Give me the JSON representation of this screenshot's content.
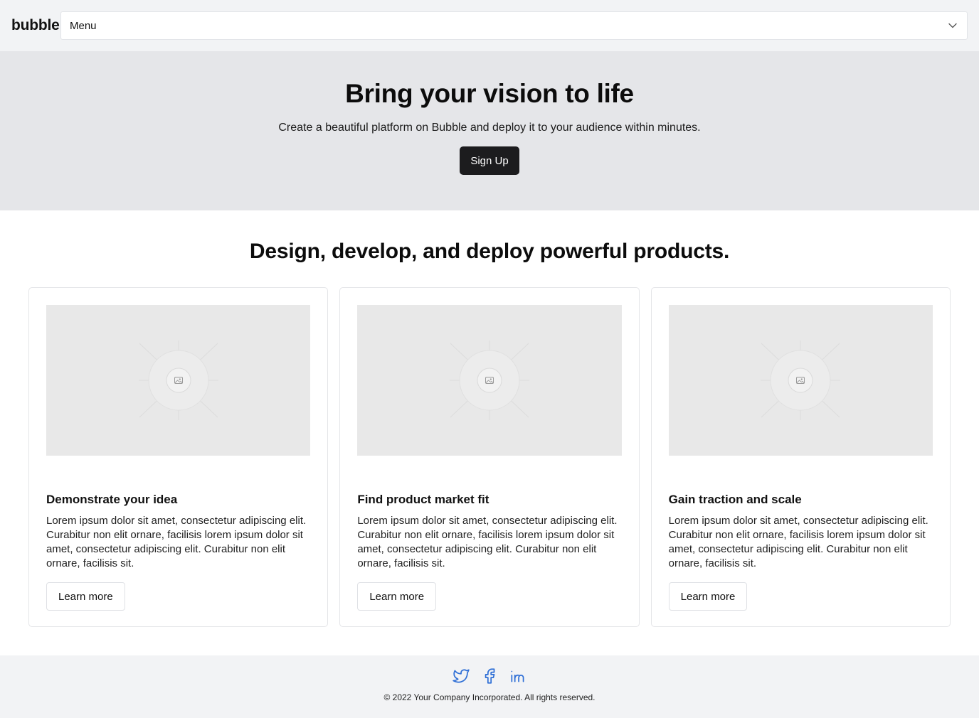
{
  "header": {
    "brand": "bubble",
    "menu": {
      "selected": "Menu"
    }
  },
  "hero": {
    "title": "Bring your vision to life",
    "subtitle": "Create a beautiful platform on Bubble and deploy it to your audience within minutes.",
    "cta_label": "Sign Up"
  },
  "features": {
    "title": "Design, develop, and deploy powerful products.",
    "cards": [
      {
        "title": "Demonstrate your idea",
        "text": "Lorem ipsum dolor sit amet, consectetur adipiscing elit. Curabitur non elit ornare, facilisis lorem ipsum dolor sit amet, consectetur adipiscing elit. Curabitur non elit ornare, facilisis sit.",
        "button_label": "Learn more",
        "image_icon": "image-placeholder-icon"
      },
      {
        "title": "Find product market fit",
        "text": "Lorem ipsum dolor sit amet, consectetur adipiscing elit. Curabitur non elit ornare, facilisis lorem ipsum dolor sit amet, consectetur adipiscing elit. Curabitur non elit ornare, facilisis sit.",
        "button_label": "Learn more",
        "image_icon": "image-placeholder-icon"
      },
      {
        "title": "Gain traction and scale",
        "text": "Lorem ipsum dolor sit amet, consectetur adipiscing elit. Curabitur non elit ornare, facilisis lorem ipsum dolor sit amet, consectetur adipiscing elit. Curabitur non elit ornare, facilisis sit.",
        "button_label": "Learn more",
        "image_icon": "image-placeholder-icon"
      }
    ]
  },
  "footer": {
    "social_icons": [
      "twitter-icon",
      "facebook-icon",
      "linkedin-icon"
    ],
    "social_color": "#2f6fd6",
    "copyright": "© 2022 Your Company Incorporated. All rights reserved."
  }
}
